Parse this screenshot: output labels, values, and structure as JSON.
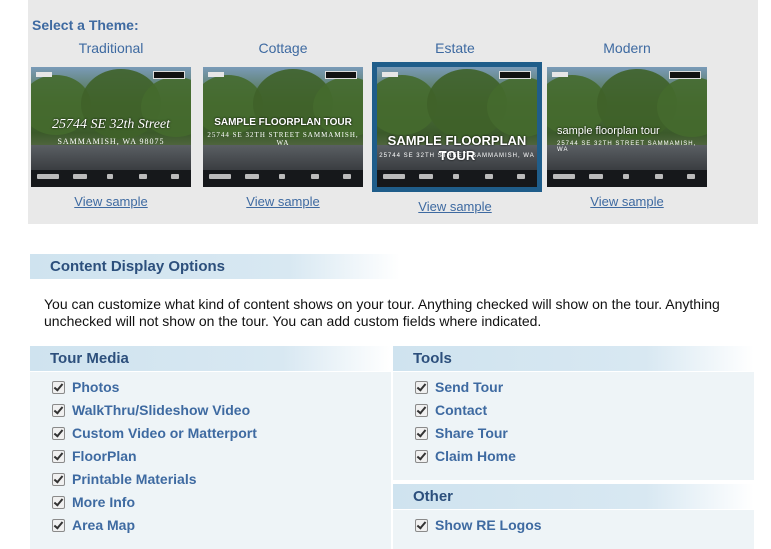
{
  "themes": {
    "heading": "Select a Theme:",
    "items": [
      {
        "name": "Traditional",
        "headline": "25744 SE 32th Street",
        "subline": "SAMMAMISH, WA 98075",
        "link": "View sample"
      },
      {
        "name": "Cottage",
        "headline": "SAMPLE FLOORPLAN TOUR",
        "subline": "25744 SE 32TH STREET SAMMAMISH, WA",
        "link": "View sample"
      },
      {
        "name": "Estate",
        "headline": "SAMPLE FLOORPLAN TOUR",
        "subline": "25744 SE 32TH STREET, SAMMAMISH, WA",
        "link": "View sample"
      },
      {
        "name": "Modern",
        "headline": "sample floorplan tour",
        "subline": "25744 SE 32TH STREET SAMMAMISH, WA",
        "link": "View sample"
      }
    ],
    "selected": "Estate"
  },
  "content_display": {
    "title": "Content Display Options",
    "description": "You can customize what kind of content shows on your tour. Anything checked will show on the tour. Anything unchecked will not show on the tour. You can add custom fields where indicated."
  },
  "tour_media": {
    "title": "Tour Media",
    "items": [
      {
        "label": "Photos",
        "checked": true
      },
      {
        "label": "WalkThru/Slideshow Video",
        "checked": true
      },
      {
        "label": "Custom Video or Matterport",
        "checked": true
      },
      {
        "label": "FloorPlan",
        "checked": true
      },
      {
        "label": "Printable Materials",
        "checked": true
      },
      {
        "label": "More Info",
        "checked": true
      },
      {
        "label": "Area Map",
        "checked": true
      }
    ]
  },
  "tools": {
    "title": "Tools",
    "items": [
      {
        "label": "Send Tour",
        "checked": true
      },
      {
        "label": "Contact",
        "checked": true
      },
      {
        "label": "Share Tour",
        "checked": true
      },
      {
        "label": "Claim Home",
        "checked": true
      }
    ]
  },
  "other": {
    "title": "Other",
    "items": [
      {
        "label": "Show RE Logos",
        "checked": true
      }
    ]
  },
  "colors": {
    "accent_text": "#3e6aa1",
    "selected_border": "#1f5d8a",
    "section_header": "#cfe3ef"
  }
}
